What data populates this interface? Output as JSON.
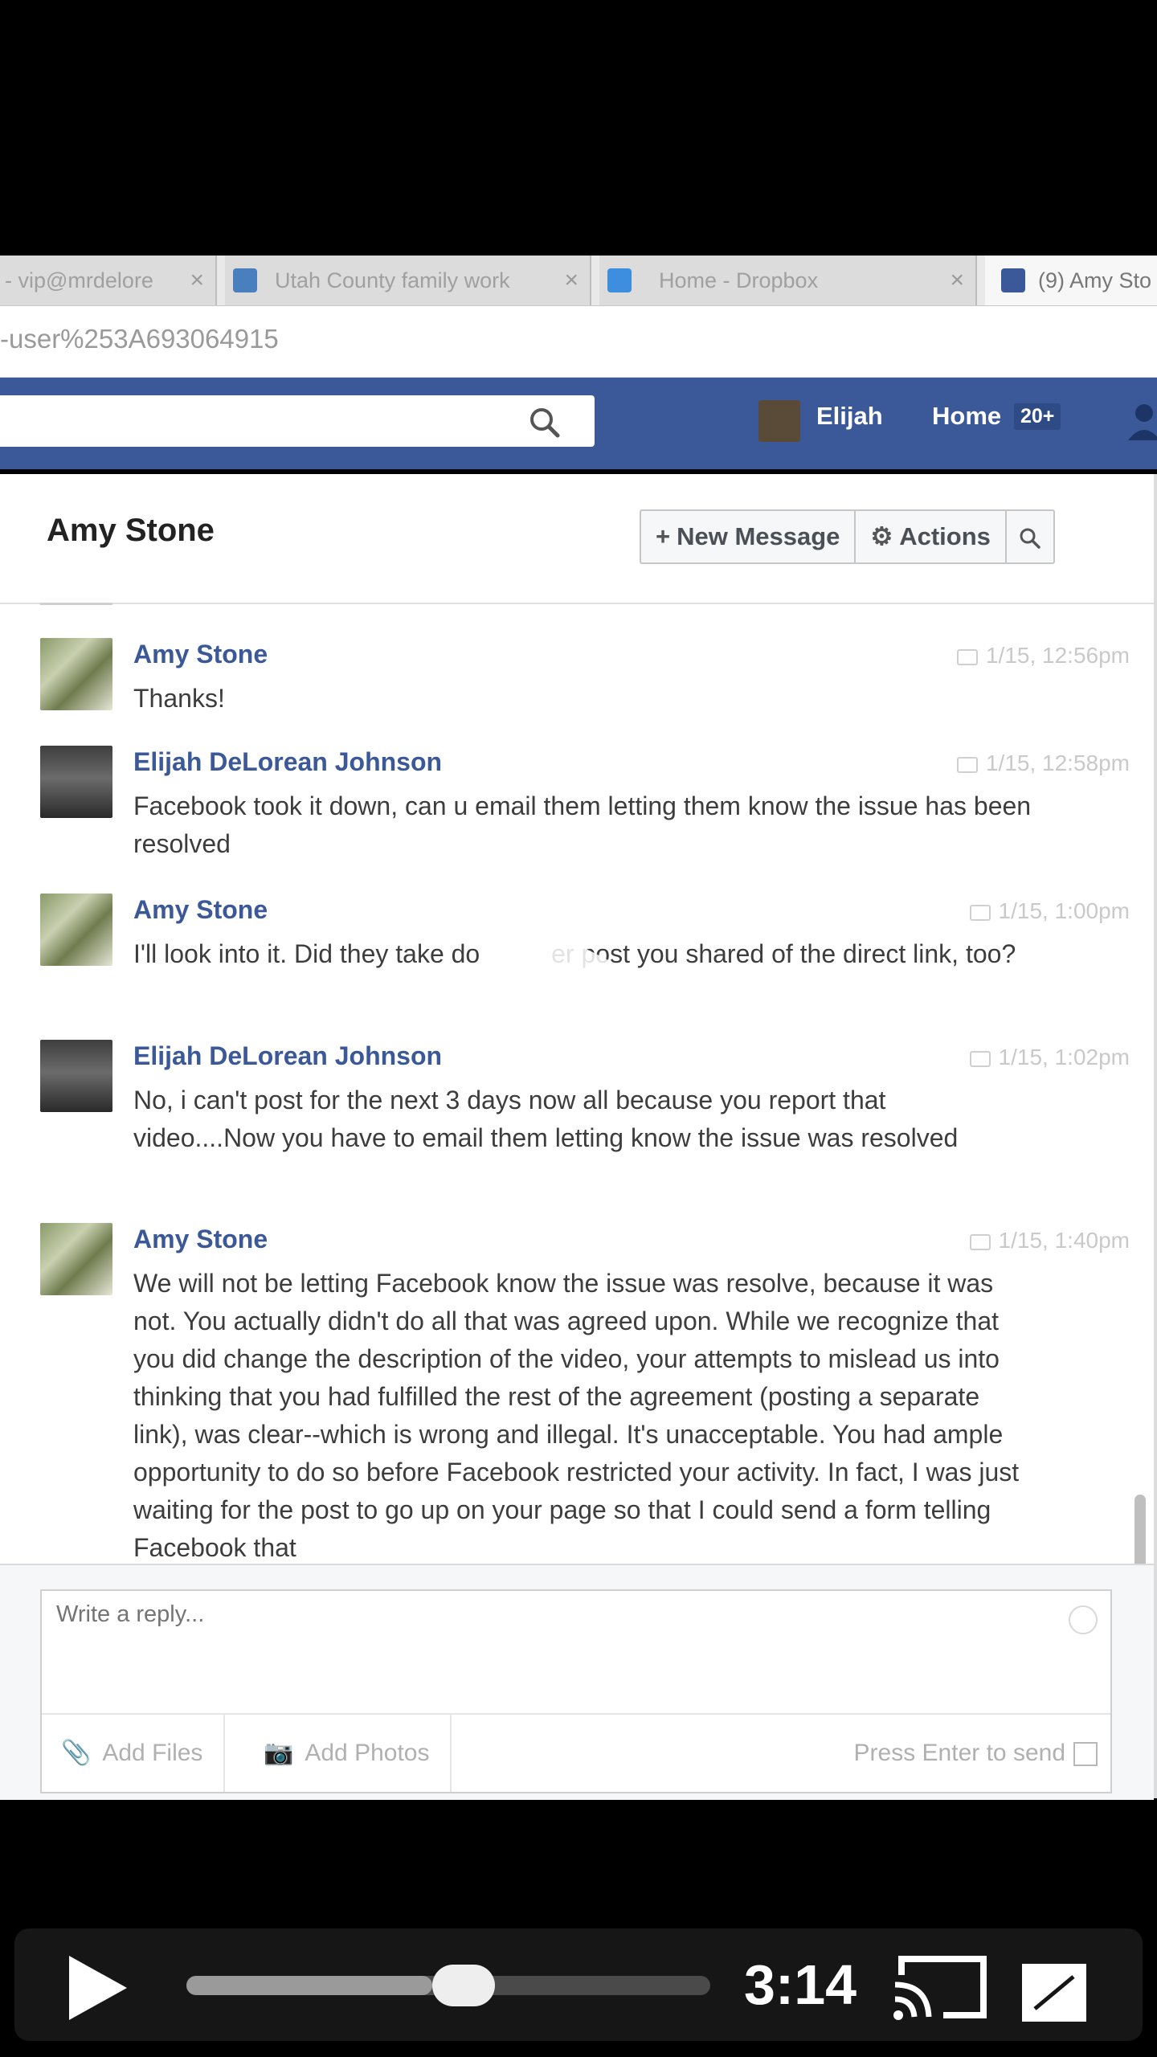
{
  "browser": {
    "tabs": [
      {
        "label": "- vip@mrdelore"
      },
      {
        "label": "Utah County family work"
      },
      {
        "label": "Home - Dropbox"
      },
      {
        "label": "(9) Amy Sto"
      }
    ],
    "address": "-user%253A693064915"
  },
  "fb_header": {
    "user_name": "Elijah",
    "home_label": "Home",
    "home_badge": "20+"
  },
  "conversation": {
    "title": "Amy Stone",
    "new_message_label": "New Message",
    "actions_label": "Actions"
  },
  "messages": [
    {
      "name": "Amy Stone",
      "time": "1/15, 12:56pm",
      "text": "Thanks!"
    },
    {
      "name": "Elijah DeLorean Johnson",
      "time": "1/15, 12:58pm",
      "text": "Facebook took it down, can u email them letting them know the issue has been resolved"
    },
    {
      "name": "Amy Stone",
      "time": "1/15, 1:00pm",
      "text": "I'll look into it. Did they take do          er post you shared of the direct link, too?"
    },
    {
      "name": "Elijah DeLorean Johnson",
      "time": "1/15, 1:02pm",
      "text": "No, i can't post for the next 3 days now all because you report that video....Now you have to email them letting know the issue was resolved"
    },
    {
      "name": "Amy Stone",
      "time": "1/15, 1:40pm",
      "text": "We will not be letting Facebook know the issue was resolve, because it was not. You actually didn't do all that was agreed upon. While we recognize that you did change the description of the video, your attempts to mislead us into thinking that you had fulfilled the rest of the agreement (posting a separate link), was clear--which is wrong and illegal. It's unacceptable. You had ample opportunity to do so before Facebook restricted your activity. In fact, I was just waiting for the post to go up on your page so that I could send a form telling Facebook that"
    }
  ],
  "composer": {
    "placeholder": "Write a reply...",
    "add_files": "Add Files",
    "add_photos": "Add Photos",
    "press_enter": "Press Enter to send"
  },
  "video": {
    "timecode": "3:14",
    "progress": 0.47
  },
  "colors": {
    "fb_blue": "#3b5998",
    "name_blue": "#3b5998"
  }
}
